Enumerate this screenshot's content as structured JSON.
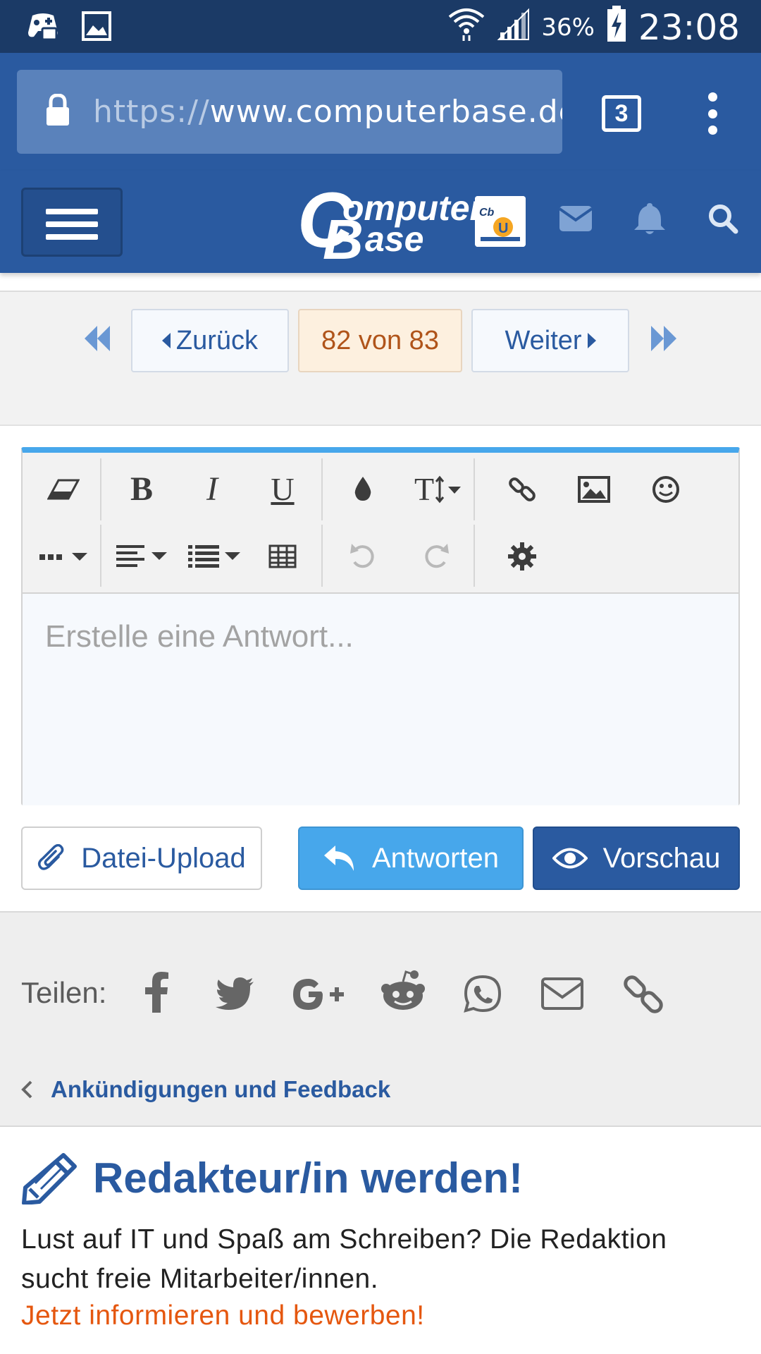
{
  "status_bar": {
    "battery": "36%",
    "clock": "23:08",
    "icons": [
      "game-controller-icon",
      "image-icon",
      "wifi-icon",
      "cell-signal-icon",
      "battery-charging-icon"
    ]
  },
  "browser": {
    "url_scheme": "https://",
    "url_host": "www.computerbase.de/",
    "tab_count": "3",
    "icons": [
      "lock-icon",
      "tabs-icon",
      "overflow-menu-icon"
    ]
  },
  "header": {
    "logo_main": "C",
    "logo_second": "B",
    "logo_top": "omputer",
    "logo_bottom": "ase",
    "icons": [
      "menu-icon",
      "mail-icon",
      "bell-icon",
      "search-icon"
    ]
  },
  "pagination": {
    "prev": "Zurück",
    "current": "82 von 83",
    "next": "Weiter"
  },
  "editor": {
    "placeholder": "Erstelle eine Antwort...",
    "toolbar_icons": [
      "eraser-icon",
      "bold-icon",
      "italic-icon",
      "underline-icon",
      "color-drop-icon",
      "font-size-icon",
      "link-icon",
      "image-icon",
      "smiley-icon",
      "more-icon",
      "align-icon",
      "list-icon",
      "table-icon",
      "undo-icon",
      "redo-icon",
      "gear-icon"
    ]
  },
  "actions": {
    "upload": "Datei-Upload",
    "reply": "Antworten",
    "preview": "Vorschau"
  },
  "share": {
    "label": "Teilen:",
    "icons": [
      "facebook-icon",
      "twitter-icon",
      "google-plus-icon",
      "reddit-icon",
      "whatsapp-icon",
      "email-icon",
      "link-icon"
    ],
    "breadcrumb": "Ankündigungen und Feedback"
  },
  "promo": {
    "title": "Redakteur/in werden!",
    "body": "Lust auf IT und Spaß am Schreiben? Die Redaktion sucht freie Mitarbeiter/innen.",
    "cta": "Jetzt informieren und bewerben!"
  },
  "colors": {
    "brand_blue": "#2a5aa0",
    "status_bar": "#1b3a66",
    "accent_light_blue": "#47a7eb",
    "current_page_text": "#b0541a",
    "cta_orange": "#e5570f"
  }
}
